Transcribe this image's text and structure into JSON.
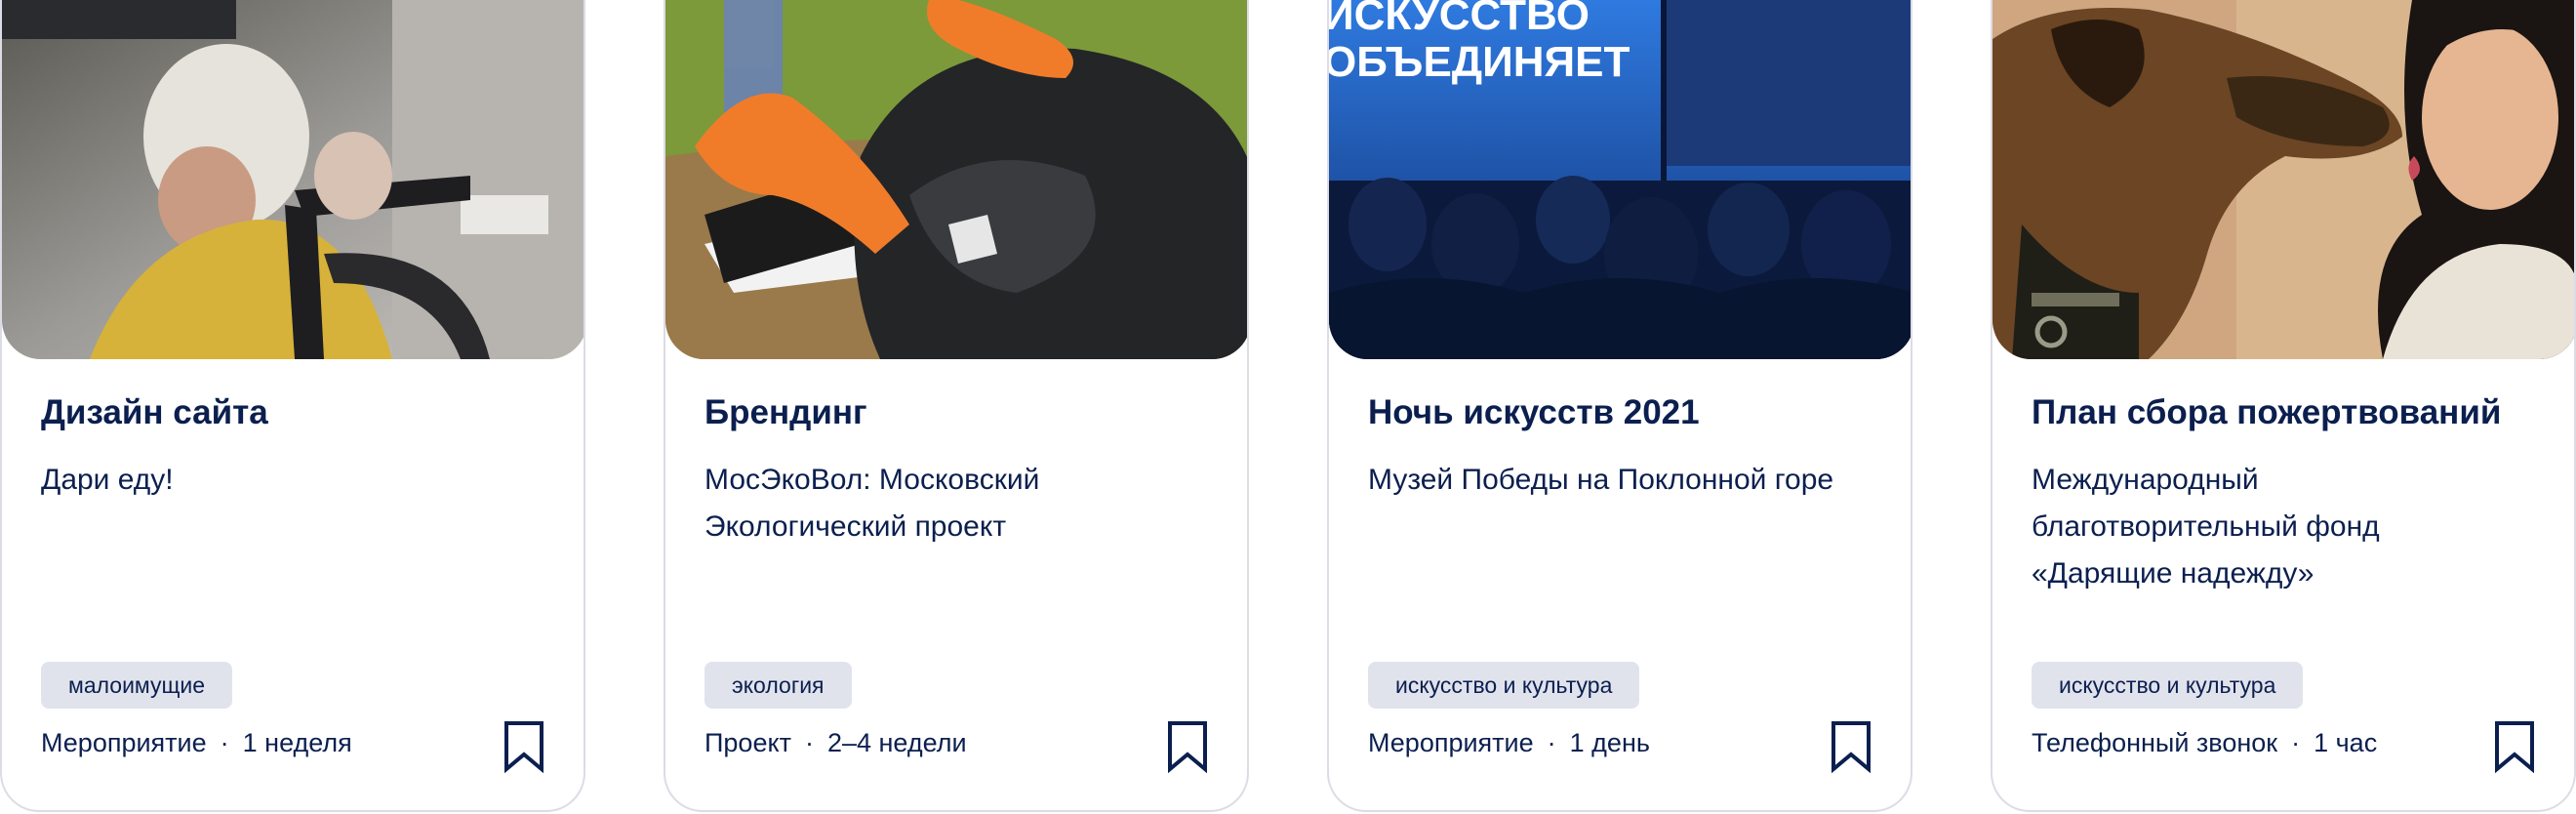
{
  "cards": [
    {
      "title": "Дизайн сайта",
      "organization": "Дари еду!",
      "tag": "малоимущие",
      "type": "Мероприятие",
      "duration": "1 неделя",
      "image_icon": "elderly-person-photo"
    },
    {
      "title": "Брендинг",
      "organization": "МосЭкоВол: Московский Экологический проект",
      "tag": "экология",
      "type": "Проект",
      "duration": "2–4 недели",
      "image_icon": "garbage-collecting-photo"
    },
    {
      "title": "Ночь искусств 2021",
      "organization": "Музей Победы на Поклонной горе",
      "tag": "искусство и культура",
      "type": "Мероприятие",
      "duration": "1 день",
      "image_icon": "audience-photo",
      "image_text_line1": "ИСКУССТВО",
      "image_text_line2": "ОБЪЕДИНЯЕТ"
    },
    {
      "title": "План сбора пожертвований",
      "organization": "Международный благотворительный фонд «Дарящие надежду»",
      "tag": "искусство и культура",
      "type": "Телефонный звонок",
      "duration": "1 час",
      "image_icon": "dog-and-woman-photo"
    }
  ],
  "colors": {
    "text": "#0b1f4f",
    "tag_background": "#e1e3ec",
    "card_border": "#dcdce6"
  }
}
